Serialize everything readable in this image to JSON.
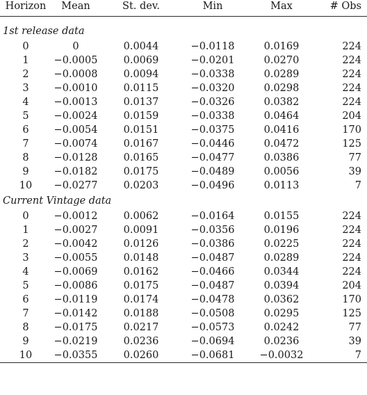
{
  "table": {
    "columns": [
      {
        "key": "horizon",
        "label": "Horizon",
        "align": "center"
      },
      {
        "key": "mean",
        "label": "Mean",
        "align": "center"
      },
      {
        "key": "sd",
        "label": "St. dev.",
        "align": "center"
      },
      {
        "key": "min",
        "label": "Min",
        "align": "center"
      },
      {
        "key": "max",
        "label": "Max",
        "align": "center"
      },
      {
        "key": "obs",
        "label": "# Obs",
        "align": "right"
      }
    ],
    "sections": [
      {
        "label": "1st release data",
        "rows": [
          {
            "horizon": "0",
            "mean": "0",
            "sd": "0.0044",
            "min": "−0.0118",
            "max": "0.0169",
            "obs": "224"
          },
          {
            "horizon": "1",
            "mean": "−0.0005",
            "sd": "0.0069",
            "min": "−0.0201",
            "max": "0.0270",
            "obs": "224"
          },
          {
            "horizon": "2",
            "mean": "−0.0008",
            "sd": "0.0094",
            "min": "−0.0338",
            "max": "0.0289",
            "obs": "224"
          },
          {
            "horizon": "3",
            "mean": "−0.0010",
            "sd": "0.0115",
            "min": "−0.0320",
            "max": "0.0298",
            "obs": "224"
          },
          {
            "horizon": "4",
            "mean": "−0.0013",
            "sd": "0.0137",
            "min": "−0.0326",
            "max": "0.0382",
            "obs": "224"
          },
          {
            "horizon": "5",
            "mean": "−0.0024",
            "sd": "0.0159",
            "min": "−0.0338",
            "max": "0.0464",
            "obs": "204"
          },
          {
            "horizon": "6",
            "mean": "−0.0054",
            "sd": "0.0151",
            "min": "−0.0375",
            "max": "0.0416",
            "obs": "170"
          },
          {
            "horizon": "7",
            "mean": "−0.0074",
            "sd": "0.0167",
            "min": "−0.0446",
            "max": "0.0472",
            "obs": "125"
          },
          {
            "horizon": "8",
            "mean": "−0.0128",
            "sd": "0.0165",
            "min": "−0.0477",
            "max": "0.0386",
            "obs": "77"
          },
          {
            "horizon": "9",
            "mean": "−0.0182",
            "sd": "0.0175",
            "min": "−0.0489",
            "max": "0.0056",
            "obs": "39"
          },
          {
            "horizon": "10",
            "mean": "−0.0277",
            "sd": "0.0203",
            "min": "−0.0496",
            "max": "0.0113",
            "obs": "7"
          }
        ]
      },
      {
        "label": "Current Vintage data",
        "rows": [
          {
            "horizon": "0",
            "mean": "−0.0012",
            "sd": "0.0062",
            "min": "−0.0164",
            "max": "0.0155",
            "obs": "224"
          },
          {
            "horizon": "1",
            "mean": "−0.0027",
            "sd": "0.0091",
            "min": "−0.0356",
            "max": "0.0196",
            "obs": "224"
          },
          {
            "horizon": "2",
            "mean": "−0.0042",
            "sd": "0.0126",
            "min": "−0.0386",
            "max": "0.0225",
            "obs": "224"
          },
          {
            "horizon": "3",
            "mean": "−0.0055",
            "sd": "0.0148",
            "min": "−0.0487",
            "max": "0.0289",
            "obs": "224"
          },
          {
            "horizon": "4",
            "mean": "−0.0069",
            "sd": "0.0162",
            "min": "−0.0466",
            "max": "0.0344",
            "obs": "224"
          },
          {
            "horizon": "5",
            "mean": "−0.0086",
            "sd": "0.0175",
            "min": "−0.0487",
            "max": "0.0394",
            "obs": "204"
          },
          {
            "horizon": "6",
            "mean": "−0.0119",
            "sd": "0.0174",
            "min": "−0.0478",
            "max": "0.0362",
            "obs": "170"
          },
          {
            "horizon": "7",
            "mean": "−0.0142",
            "sd": "0.0188",
            "min": "−0.0508",
            "max": "0.0295",
            "obs": "125"
          },
          {
            "horizon": "8",
            "mean": "−0.0175",
            "sd": "0.0217",
            "min": "−0.0573",
            "max": "0.0242",
            "obs": "77"
          },
          {
            "horizon": "9",
            "mean": "−0.0219",
            "sd": "0.0236",
            "min": "−0.0694",
            "max": "0.0236",
            "obs": "39"
          },
          {
            "horizon": "10",
            "mean": "−0.0355",
            "sd": "0.0260",
            "min": "−0.0681",
            "max": "−0.0032",
            "obs": "7"
          }
        ]
      }
    ]
  }
}
